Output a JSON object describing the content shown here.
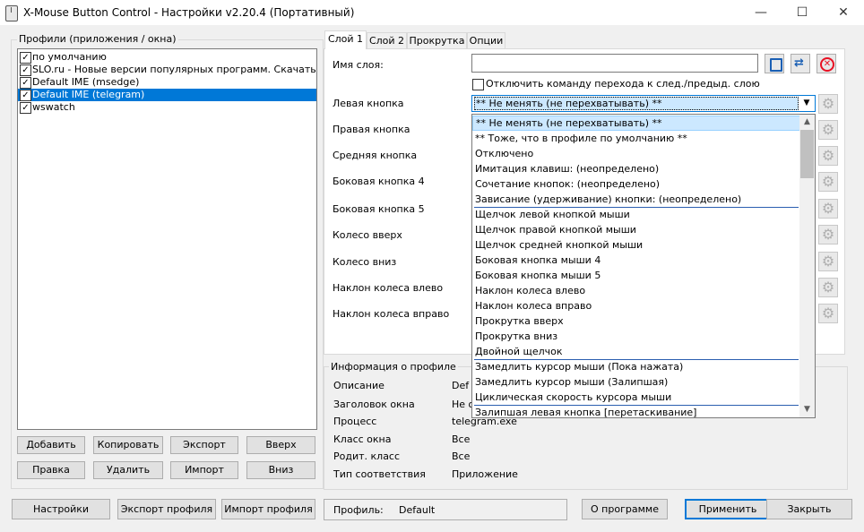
{
  "window": {
    "title": "X-Mouse Button Control - Настройки v2.20.4 (Портативный)",
    "minimize": "—",
    "maximize": "☐",
    "close": "✕"
  },
  "profiles": {
    "group_label": "Профили (приложения / окна)",
    "items": [
      {
        "label": "по умолчанию",
        "checked": true,
        "selected": false
      },
      {
        "label": "SLO.ru - Новые версии популярных программ. Скачать про...",
        "checked": true,
        "selected": false
      },
      {
        "label": "Default IME (msedge)",
        "checked": true,
        "selected": false
      },
      {
        "label": "Default IME (telegram)",
        "checked": true,
        "selected": true
      },
      {
        "label": "wswatch",
        "checked": true,
        "selected": false
      }
    ],
    "buttons": {
      "add": "Добавить",
      "copy": "Копировать",
      "export": "Экспорт",
      "up": "Вверх",
      "edit": "Правка",
      "delete": "Удалить",
      "import": "Импорт",
      "down": "Вниз"
    }
  },
  "tabs": [
    "Слой 1",
    "Слой 2",
    "Прокрутка",
    "Опции"
  ],
  "layer": {
    "name_label": "Имя слоя:",
    "name_value": "",
    "disable_switch_label": "Отключить команду перехода к след./предыд. слою",
    "buttons": [
      {
        "label": "Левая кнопка"
      },
      {
        "label": "Правая кнопка"
      },
      {
        "label": "Средняя кнопка"
      },
      {
        "label": "Боковая кнопка 4"
      },
      {
        "label": "Боковая кнопка 5"
      },
      {
        "label": "Колесо вверх"
      },
      {
        "label": "Колесо вниз"
      },
      {
        "label": "Наклон колеса влево"
      },
      {
        "label": "Наклон колеса вправо"
      }
    ],
    "combo_value": "** Не менять (не перехватывать) **",
    "dropdown_options": [
      "** Не менять (не перехватывать) **",
      "** Тоже, что в профиле по умолчанию **",
      "Отключено",
      "Имитация клавиш: (неопределено)",
      "Сочетание кнопок: (неопределено)",
      "Зависание (удерживание) кнопки: (неопределено)",
      "Щелчок левой кнопкой мыши",
      "Щелчок правой кнопкой мыши",
      "Щелчок средней кнопкой мыши",
      "Боковая кнопка мыши 4",
      "Боковая кнопка мыши 5",
      "Наклон колеса влево",
      "Наклон колеса вправо",
      "Прокрутка вверх",
      "Прокрутка вниз",
      "Двойной щелчок",
      "Замедлить курсор мыши (Пока нажата)",
      "Замедлить курсор мыши (Залипшая)",
      "Циклическая скорость курсора мыши",
      "Залипшая левая кнопка [перетаскивание]"
    ]
  },
  "profile_info": {
    "group_label": "Информация о профиле",
    "rows": [
      {
        "label": "Описание",
        "value": "Def"
      },
      {
        "label": "Заголовок окна",
        "value": "Не о"
      },
      {
        "label": "Процесс",
        "value": "telegram.exe"
      },
      {
        "label": "Класс окна",
        "value": "Все"
      },
      {
        "label": "Родит. класс",
        "value": "Все"
      },
      {
        "label": "Тип соответствия",
        "value": "Приложение"
      }
    ]
  },
  "footer": {
    "settings": "Настройки",
    "export_profile": "Экспорт профиля",
    "import_profile": "Импорт профиля",
    "profile_label": "Профиль:",
    "profile_value": "Default",
    "about": "О программе",
    "apply": "Применить",
    "close": "Закрыть"
  },
  "colors": {
    "selection": "#0078d7",
    "highlight": "#cce8ff",
    "red_icon": "#e81123",
    "blue_icon": "#1a5fb4"
  }
}
